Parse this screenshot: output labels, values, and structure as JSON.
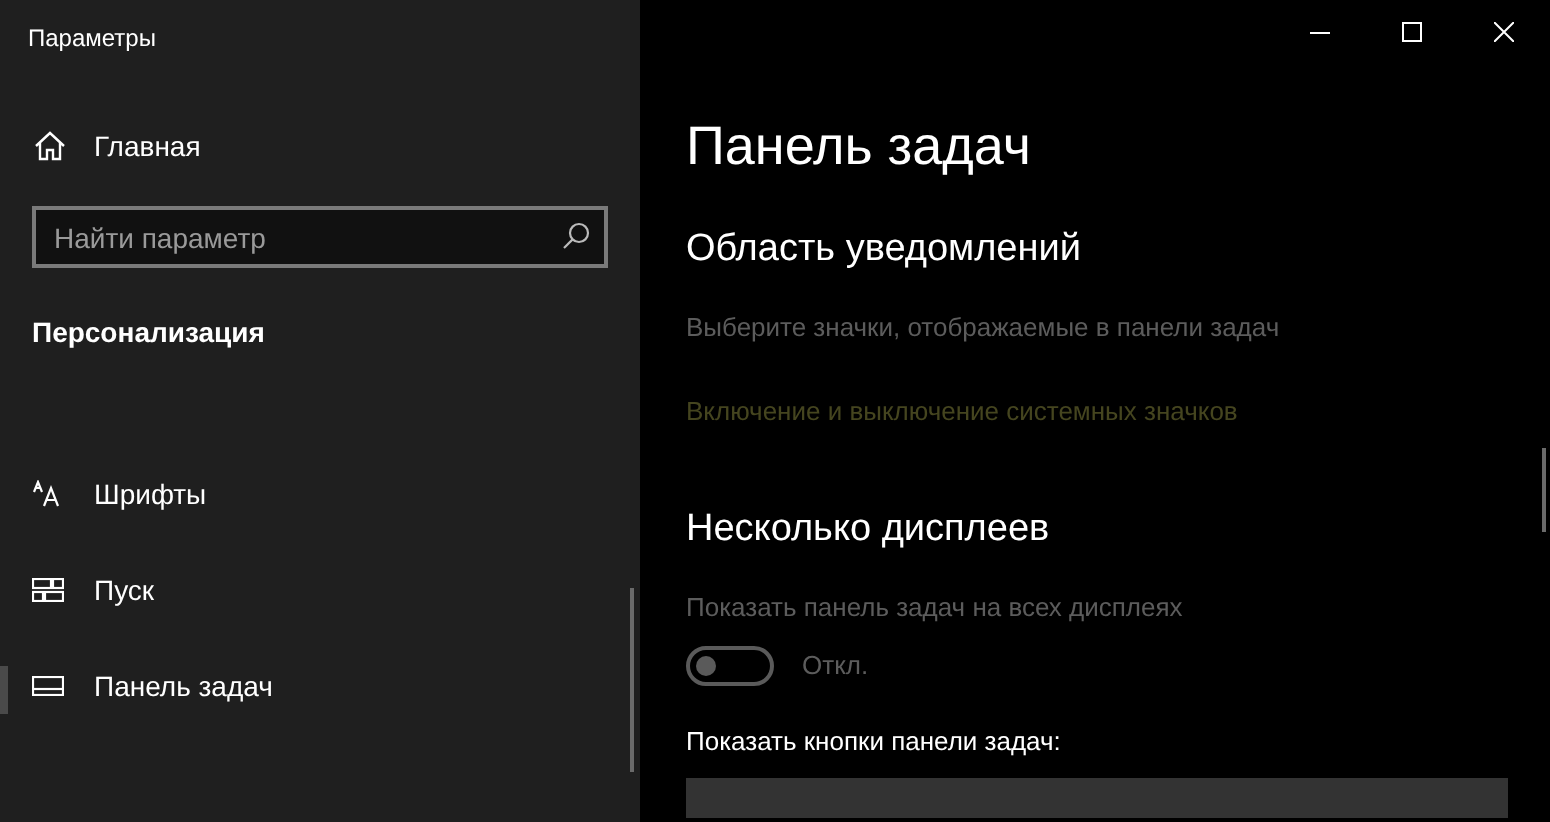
{
  "window": {
    "title": "Параметры"
  },
  "sidebar": {
    "home": {
      "label": "Главная"
    },
    "search": {
      "placeholder": "Найти параметр"
    },
    "section": "Персонализация",
    "items": [
      {
        "label": "Шрифты",
        "kind": "fonts",
        "selected": false
      },
      {
        "label": "Пуск",
        "kind": "start",
        "selected": false
      },
      {
        "label": "Панель задач",
        "kind": "taskbar",
        "selected": true
      }
    ]
  },
  "page": {
    "title": "Панель задач",
    "sections": [
      {
        "heading": "Область уведомлений",
        "rows": [
          {
            "kind": "text",
            "text": "Выберите значки, отображаемые в панели задач",
            "disabled": true
          },
          {
            "kind": "link",
            "text": "Включение и выключение системных значков",
            "disabled": true
          }
        ]
      },
      {
        "heading": "Несколько дисплеев",
        "rows": [
          {
            "kind": "text",
            "text": "Показать панель задач на всех дисплеях",
            "disabled": true
          },
          {
            "kind": "toggle",
            "on": false,
            "disabled": true,
            "state_label": "Откл."
          },
          {
            "kind": "label",
            "text": "Показать кнопки панели задач:"
          },
          {
            "kind": "dropdown"
          }
        ]
      }
    ]
  }
}
